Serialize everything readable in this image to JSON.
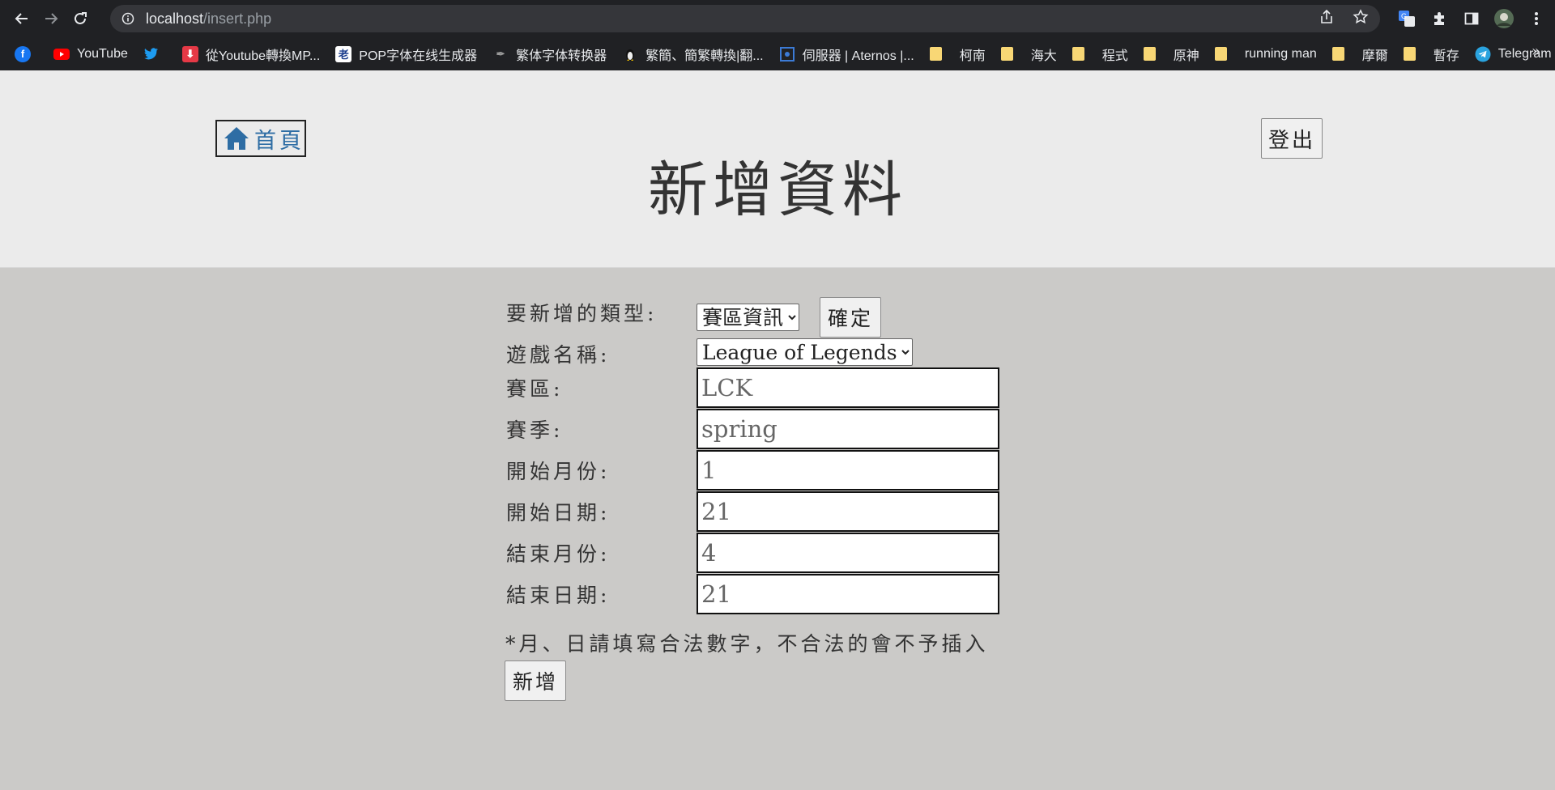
{
  "browser": {
    "url_host": "localhost",
    "url_path": "/insert.php",
    "bookmarks": [
      {
        "label": "",
        "icon": "facebook-icon",
        "color": "#1877f2"
      },
      {
        "label": "YouTube",
        "icon": "youtube-icon",
        "color": "#ff0000"
      },
      {
        "label": "",
        "icon": "twitter-icon",
        "color": "#1d9bf0"
      },
      {
        "label": "從Youtube轉換MP...",
        "icon": "download-icon",
        "color": "#e53946"
      },
      {
        "label": "POP字体在线生成器",
        "icon": "pop-icon",
        "color": "#ffffff"
      },
      {
        "label": "繁体字体转换器",
        "icon": "converter-icon",
        "color": "#444444"
      },
      {
        "label": "繁簡、簡繁轉換|翻...",
        "icon": "penguin-icon",
        "color": "#f5c400"
      },
      {
        "label": "伺服器 | Aternos |...",
        "icon": "aternos-icon",
        "color": "#3c7bd6"
      },
      {
        "label": "柯南",
        "icon": "folder-icon",
        "color": "#f8d775"
      },
      {
        "label": "海大",
        "icon": "folder-icon",
        "color": "#f8d775"
      },
      {
        "label": "程式",
        "icon": "folder-icon",
        "color": "#f8d775"
      },
      {
        "label": "原神",
        "icon": "folder-icon",
        "color": "#f8d775"
      },
      {
        "label": "running man",
        "icon": "folder-icon",
        "color": "#f8d775"
      },
      {
        "label": "摩爾",
        "icon": "folder-icon",
        "color": "#f8d775"
      },
      {
        "label": "暫存",
        "icon": "folder-icon",
        "color": "#f8d775"
      },
      {
        "label": "Telegram Web",
        "icon": "telegram-icon",
        "color": "#2aa3df"
      }
    ],
    "more": "»"
  },
  "header": {
    "home_label": "首頁",
    "title": "新增資料",
    "logout_label": "登出"
  },
  "form": {
    "type_label": "要新增的類型:",
    "type_selected": "賽區資訊",
    "confirm_label": "確定",
    "game_label": "遊戲名稱:",
    "game_selected": "League of Legends",
    "region_label": "賽區:",
    "region_placeholder": "LCK",
    "season_label": "賽季:",
    "season_placeholder": "spring",
    "start_month_label": "開始月份:",
    "start_month_placeholder": "1",
    "start_day_label": "開始日期:",
    "start_day_placeholder": "21",
    "end_month_label": "結束月份:",
    "end_month_placeholder": "4",
    "end_day_label": "結束日期:",
    "end_day_placeholder": "21",
    "note": "*月、日請填寫合法數字，不合法的會不予插入",
    "submit_label": "新增"
  },
  "colors": {
    "page_bg": "#cbcac8",
    "header_bg": "#ebebeb",
    "home_link": "#2e6da4"
  }
}
